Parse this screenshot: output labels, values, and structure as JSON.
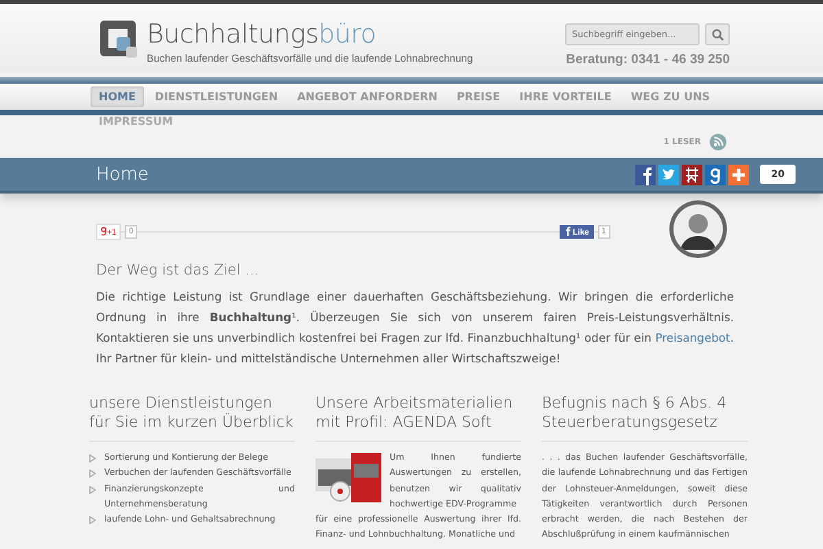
{
  "header": {
    "logo_text": "Buchhaltungs",
    "logo_accent": "büro",
    "tagline": "Buchen laufender Geschäftsvorfälle und die laufende Lohnabrechnung",
    "search": {
      "placeholder": "Suchbegriff eingeben..."
    },
    "phone": "Beratung: 0341 - 46 39 250"
  },
  "nav": [
    {
      "label": "HOME",
      "selected": true
    },
    {
      "label": "DIENSTLEISTUNGEN",
      "selected": false
    },
    {
      "label": "ANGEBOT ANFORDERN",
      "selected": false
    },
    {
      "label": "PREISE",
      "selected": false
    },
    {
      "label": "IHRE VORTEILE",
      "selected": false
    },
    {
      "label": "WEG ZU UNS",
      "selected": false
    },
    {
      "label": "IMPRESSUM",
      "selected": false
    }
  ],
  "readers": "1 LESER",
  "page_title": "Home",
  "share": {
    "count": "20"
  },
  "gplus": {
    "label": "+1",
    "count": "0"
  },
  "like": {
    "label": "Like",
    "count": "1"
  },
  "intro": {
    "heading": "Der Weg ist das Ziel ...",
    "before": "Die richtige Leistung ist Grundlage einer dauerhaften Geschäftsbeziehung. Wir bringen die erforderliche Ordnung in ihre **Buchhaltung**¹. Überzeugen Sie sich von unserem fairen Preis-Leistungsverhältnis. Kontaktieren sie uns unverbindlich kostenfrei bei Fragen zur lfd. Finanzbuchhaltung¹ oder für ein",
    "link": "Preisangebot",
    "after": ". Ihr Partner für klein- und mittelständische Unternehmen aller Wirtschaftszweige!"
  },
  "columns": [
    {
      "kind": "list",
      "heading": "unsere Dienstleistungen für Sie im kurzen Überblick",
      "items": [
        "Sortierung und Kontierung der Belege",
        "Verbuchen der laufenden Geschäftsvorfälle",
        "Finanzierungskonzepte und Unternehmensberatung",
        "laufende Lohn- und Gehaltsabrechnung"
      ]
    },
    {
      "kind": "image_text",
      "heading": "Unsere Arbeitsmaterialien mit Profil: AGENDA Soft",
      "text": "Um Ihnen fundierte Auswertungen zu erstellen, benutzen wir qualitativ hochwertige EDV-Programme",
      "text_below": "für eine professionelle Auswertung ihrer lfd. Finanz- und Lohnbuchhaltung. Monatliche und"
    },
    {
      "kind": "text",
      "heading": "Befugnis nach § 6 Abs. 4 Steuerberatungsgesetz",
      "text": ". . . das Buchen laufender Geschäftsvorfälle, die laufende Lohnabrechnung und das Fertigen der Lohnsteuer-Anmeldungen, soweit diese Tätigkeiten verantwortlich durch Personen erbracht werden, die nach Bestehen der Abschlußprüfung in einem kaufmännischen"
    }
  ]
}
